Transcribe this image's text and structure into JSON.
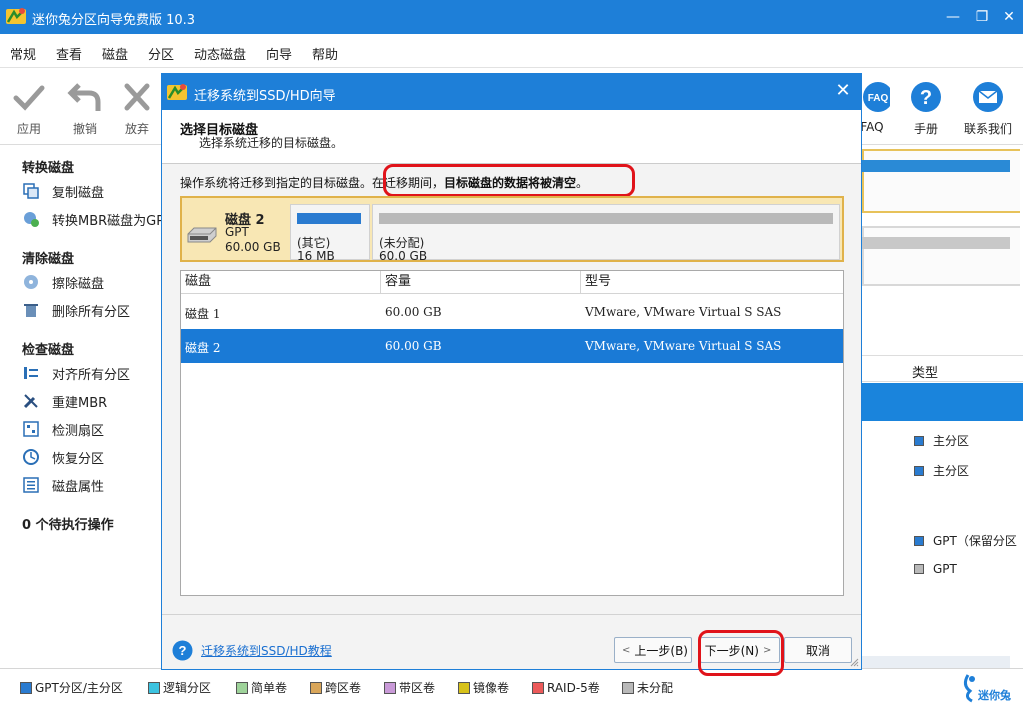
{
  "window": {
    "title": "迷你兔分区向导免费版 10.3",
    "minimize": "—",
    "maximize": "❐",
    "close": "✕"
  },
  "menu": [
    "常规",
    "查看",
    "磁盘",
    "分区",
    "动态磁盘",
    "向导",
    "帮助"
  ],
  "toolbar": {
    "left": [
      {
        "label": "应用",
        "icon": "check-icon"
      },
      {
        "label": "撤销",
        "icon": "undo-icon"
      },
      {
        "label": "放弃",
        "icon": "discard-icon"
      }
    ],
    "right": [
      {
        "label": "FAQ",
        "icon": "faq-icon"
      },
      {
        "label": "手册",
        "icon": "manual-icon"
      },
      {
        "label": "联系我们",
        "icon": "contact-icon"
      }
    ]
  },
  "sidebar": {
    "convert": {
      "title": "转换磁盘",
      "items": [
        "复制磁盘",
        "转换MBR磁盘为GPT"
      ]
    },
    "clean": {
      "title": "清除磁盘",
      "items": [
        "擦除磁盘",
        "删除所有分区"
      ]
    },
    "check": {
      "title": "检查磁盘",
      "items": [
        "对齐所有分区",
        "重建MBR",
        "检测扇区",
        "恢复分区",
        "磁盘属性"
      ]
    },
    "pending": "0 个待执行操作"
  },
  "background": {
    "type_header": "类型",
    "items": [
      "主分区",
      "主分区",
      "GPT（保留分区",
      "GPT"
    ]
  },
  "legend": [
    {
      "label": "GPT分区/主分区",
      "color": "#2a7bd0"
    },
    {
      "label": "逻辑分区",
      "color": "#3cc3e0"
    },
    {
      "label": "简单卷",
      "color": "#9ed39a"
    },
    {
      "label": "跨区卷",
      "color": "#d9a65a"
    },
    {
      "label": "带区卷",
      "color": "#c99ad8"
    },
    {
      "label": "镜像卷",
      "color": "#d7c21a"
    },
    {
      "label": "RAID-5卷",
      "color": "#ec5a5a"
    },
    {
      "label": "未分配",
      "color": "#b9b9b9"
    }
  ],
  "brand": "迷你兔",
  "dialog": {
    "title": "迁移系统到SSD/HD向导",
    "close": "✕",
    "heading": "选择目标磁盘",
    "subheading": "选择系统迁移的目标磁盘。",
    "notice_prefix": "操作系统将迁移到指定的目标磁盘。",
    "notice_mid": "在迁移期间，",
    "notice_warning": "目标磁盘的数据将被清空",
    "notice_suffix": "。",
    "disk_map": {
      "name": "磁盘 2",
      "type": "GPT",
      "size": "60.00 GB",
      "partitions": [
        {
          "label": "(其它)",
          "size": "16 MB",
          "bar_color": "#2a7bd0"
        },
        {
          "label": "(未分配)",
          "size": "60.0 GB",
          "bar_color": "#b9b9b9"
        }
      ]
    },
    "table": {
      "headers": [
        "磁盘",
        "容量",
        "型号"
      ],
      "rows": [
        {
          "disk": "磁盘 1",
          "capacity": "60.00 GB",
          "model": "VMware, VMware Virtual S SAS"
        },
        {
          "disk": "磁盘 2",
          "capacity": "60.00 GB",
          "model": "VMware, VMware Virtual S SAS"
        }
      ],
      "selected_index": 1
    },
    "help_link": "迁移系统到SSD/HD教程",
    "buttons": {
      "back": "上一步(B)",
      "next": "下一步(N)",
      "cancel": "取消"
    }
  },
  "colors": {
    "accent": "#1e7fd8",
    "selection": "#1a7ad6",
    "annotation": "#e0131a",
    "disk_highlight": "#f8e7b4"
  }
}
